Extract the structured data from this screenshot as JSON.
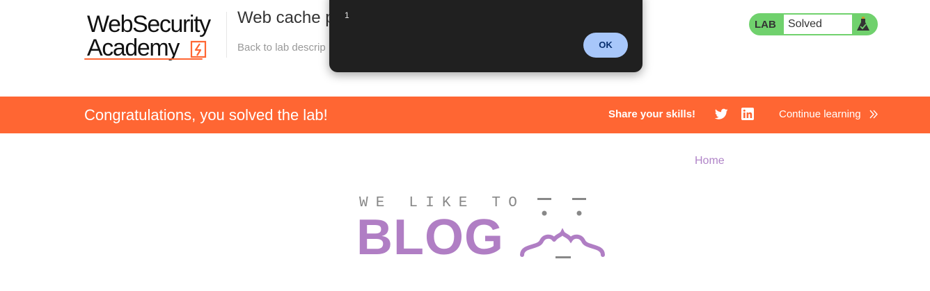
{
  "header": {
    "logo": {
      "line1": "WebSecurity",
      "line2": "Academy"
    },
    "lab_title": "Web cache p",
    "back_link": "Back to lab descrip",
    "lab_badge": {
      "label": "LAB",
      "status": "Solved",
      "icon": "flask-check-icon"
    }
  },
  "dialog": {
    "message": "1",
    "ok_label": "OK"
  },
  "banner": {
    "message": "Congratulations, you solved the lab!",
    "share_label": "Share your skills!",
    "share_icons": [
      "twitter-icon",
      "linkedin-icon"
    ],
    "continue_label": "Continue learning",
    "continue_icon": "double-chevron-right-icon"
  },
  "nav": {
    "home": "Home"
  },
  "blog_logo": {
    "tagline": "WE LIKE TO",
    "word": "BLOG"
  },
  "colors": {
    "accent_orange": "#ff6633",
    "badge_green": "#70d16d",
    "link_purple": "#b084c8",
    "blog_purple": "#b07ec4",
    "dialog_bg": "#202020",
    "ok_button": "#a8c7fa"
  }
}
